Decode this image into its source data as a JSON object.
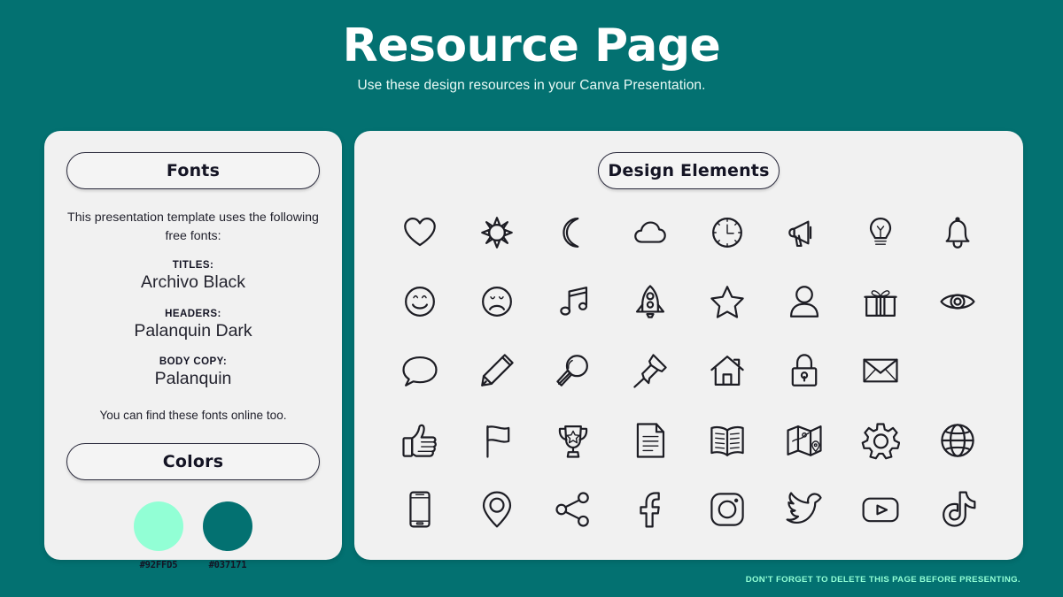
{
  "header": {
    "title": "Resource Page",
    "subtitle": "Use these design resources in your Canva Presentation."
  },
  "fonts_panel": {
    "heading": "Fonts",
    "intro": "This presentation template uses the following free fonts:",
    "groups": [
      {
        "label": "TITLES:",
        "name": "Archivo Black"
      },
      {
        "label": "HEADERS:",
        "name": "Palanquin Dark"
      },
      {
        "label": "BODY COPY:",
        "name": "Palanquin"
      }
    ],
    "outro": "You can find these fonts online too."
  },
  "colors_panel": {
    "heading": "Colors",
    "swatches": [
      {
        "hex": "#92FFD5",
        "label": "#92FFD5"
      },
      {
        "hex": "#037171",
        "label": "#037171"
      }
    ]
  },
  "elements_panel": {
    "heading": "Design Elements",
    "rows": [
      [
        "heart-icon",
        "sun-icon",
        "moon-icon",
        "cloud-icon",
        "clock-icon",
        "megaphone-icon",
        "lightbulb-icon",
        "bell-icon"
      ],
      [
        "smiley-face-icon",
        "sad-face-icon",
        "music-note-icon",
        "rocket-icon",
        "star-icon",
        "person-icon",
        "gift-icon",
        "eye-icon"
      ],
      [
        "speech-bubble-icon",
        "pencil-icon",
        "magnifier-icon",
        "pushpin-icon",
        "house-icon",
        "lock-icon",
        "envelope-icon"
      ],
      [
        "thumbs-up-icon",
        "flag-icon",
        "trophy-icon",
        "document-icon",
        "book-icon",
        "map-icon",
        "gear-icon",
        "globe-icon"
      ],
      [
        "phone-icon",
        "location-pin-icon",
        "share-icon",
        "facebook-icon",
        "instagram-icon",
        "twitter-icon",
        "youtube-icon",
        "tiktok-icon"
      ]
    ]
  },
  "footer": {
    "note": "DON'T FORGET TO DELETE THIS PAGE BEFORE PRESENTING."
  },
  "theme": {
    "background": "#037171",
    "panel": "#f1f1f1",
    "accent_mint": "#92FFD5",
    "ink": "#1d1d24"
  }
}
